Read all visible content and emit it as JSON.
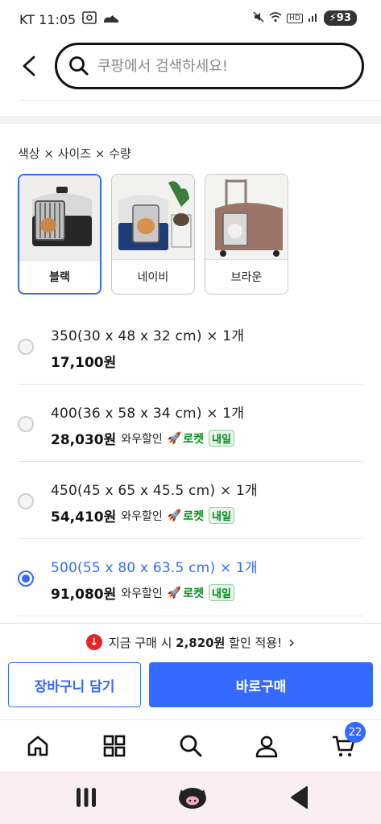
{
  "status_bar": {
    "carrier_time": "KT 11:05",
    "battery": "93",
    "hd": "HD"
  },
  "search": {
    "placeholder": "쿠팡에서 검색하세요!"
  },
  "options": {
    "title": "색상 × 사이즈 × 수량",
    "colors": [
      {
        "label": "블랙",
        "selected": true
      },
      {
        "label": "네이비",
        "selected": false
      },
      {
        "label": "브라운",
        "selected": false
      }
    ],
    "sizes": [
      {
        "name": "350(30 x 48 x 32 cm) × 1개",
        "price": "17,100원",
        "discount": "",
        "rocket": "",
        "tomorrow": "",
        "selected": false
      },
      {
        "name": "400(36 x 58 x 34 cm) × 1개",
        "price": "28,030원",
        "discount": "와우할인",
        "rocket": "로켓",
        "tomorrow": "내일",
        "selected": false
      },
      {
        "name": "450(45 x 65 x 45.5 cm) × 1개",
        "price": "54,410원",
        "discount": "와우할인",
        "rocket": "로켓",
        "tomorrow": "내일",
        "selected": false
      },
      {
        "name": "500(55 x 80 x 63.5 cm) × 1개",
        "price": "91,080원",
        "discount": "와우할인",
        "rocket": "로켓",
        "tomorrow": "내일",
        "selected": true
      }
    ]
  },
  "promo": {
    "prefix": "지금 구매 시 ",
    "amount": "2,820원",
    "suffix": " 할인 적용!",
    "chevron": "›"
  },
  "actions": {
    "cart_label": "장바구니 담기",
    "buy_label": "바로구매"
  },
  "nav": {
    "cart_count": "22"
  },
  "colors": {
    "accent": "#346aff",
    "rocket_green": "#00891a",
    "promo_red": "#e52528"
  }
}
